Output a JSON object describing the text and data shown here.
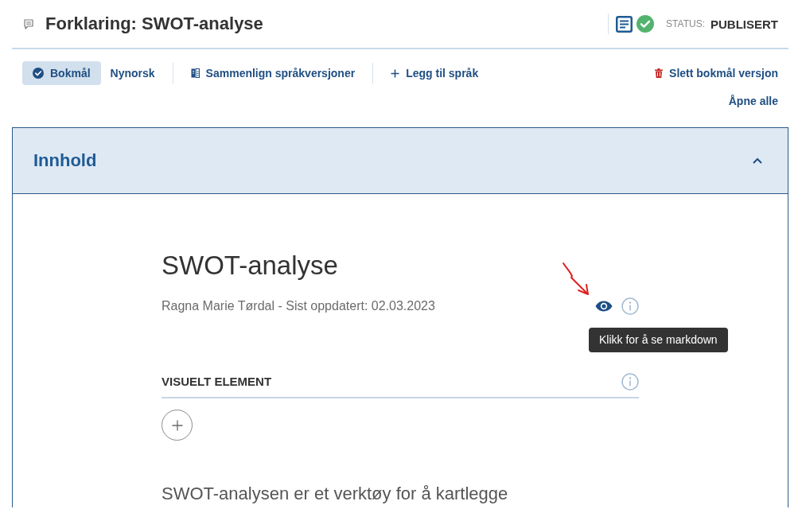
{
  "header": {
    "title": "Forklaring: SWOT-analyse",
    "published": true,
    "status_label": "STATUS:",
    "status": "PUBLISERT"
  },
  "language_tabs": [
    {
      "label": "Bokmål",
      "selected": true
    },
    {
      "label": "Nynorsk",
      "selected": false
    }
  ],
  "toolbar_actions": [
    {
      "kind": "compare",
      "label": "Sammenlign språkversjoner"
    },
    {
      "kind": "add",
      "label": "Legg til språk"
    }
  ],
  "delete_action": {
    "label": "Slett bokmål versjon"
  },
  "expand_all": {
    "label": "Åpne alle"
  },
  "panel": {
    "title": "Innhold",
    "expanded": true,
    "article": {
      "title": "SWOT-analyse",
      "byline": "Ragna Marie Tørdal - Sist oppdatert: 02.03.2023",
      "tooltip": "Klikk for å se markdown",
      "visual_element_heading": "VISUELT ELEMENT",
      "intro": "SWOT-analysen er et verktøy for å kartlegge"
    }
  }
}
